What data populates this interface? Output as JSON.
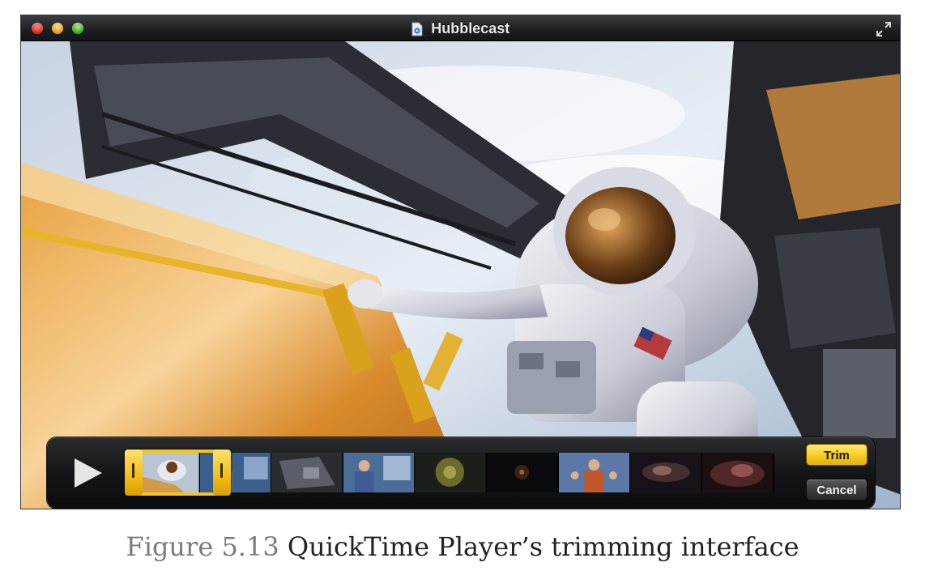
{
  "window": {
    "title": "Hubblecast",
    "title_icon": "quicktime-document-icon",
    "controls": [
      "close",
      "minimize",
      "zoom"
    ],
    "fullscreen_icon": "fullscreen-arrows-icon"
  },
  "video": {
    "description_icon": "astronaut-spacewalk-frame"
  },
  "trim_bar": {
    "play_icon": "play-icon",
    "trim_label": "Trim",
    "cancel_label": "Cancel",
    "accent_color": "#f3c623",
    "frames": [
      "astronaut-scene",
      "presenter-scene",
      "dark-equipment-scene",
      "presenter-scene",
      "telescope-mirror-scene",
      "dark-space-scene",
      "presenter-gesturing-scene",
      "nebula-scene",
      "nebula-scene"
    ]
  },
  "caption": {
    "label": "Figure 5.13",
    "text": "QuickTime Player’s trimming interface"
  }
}
